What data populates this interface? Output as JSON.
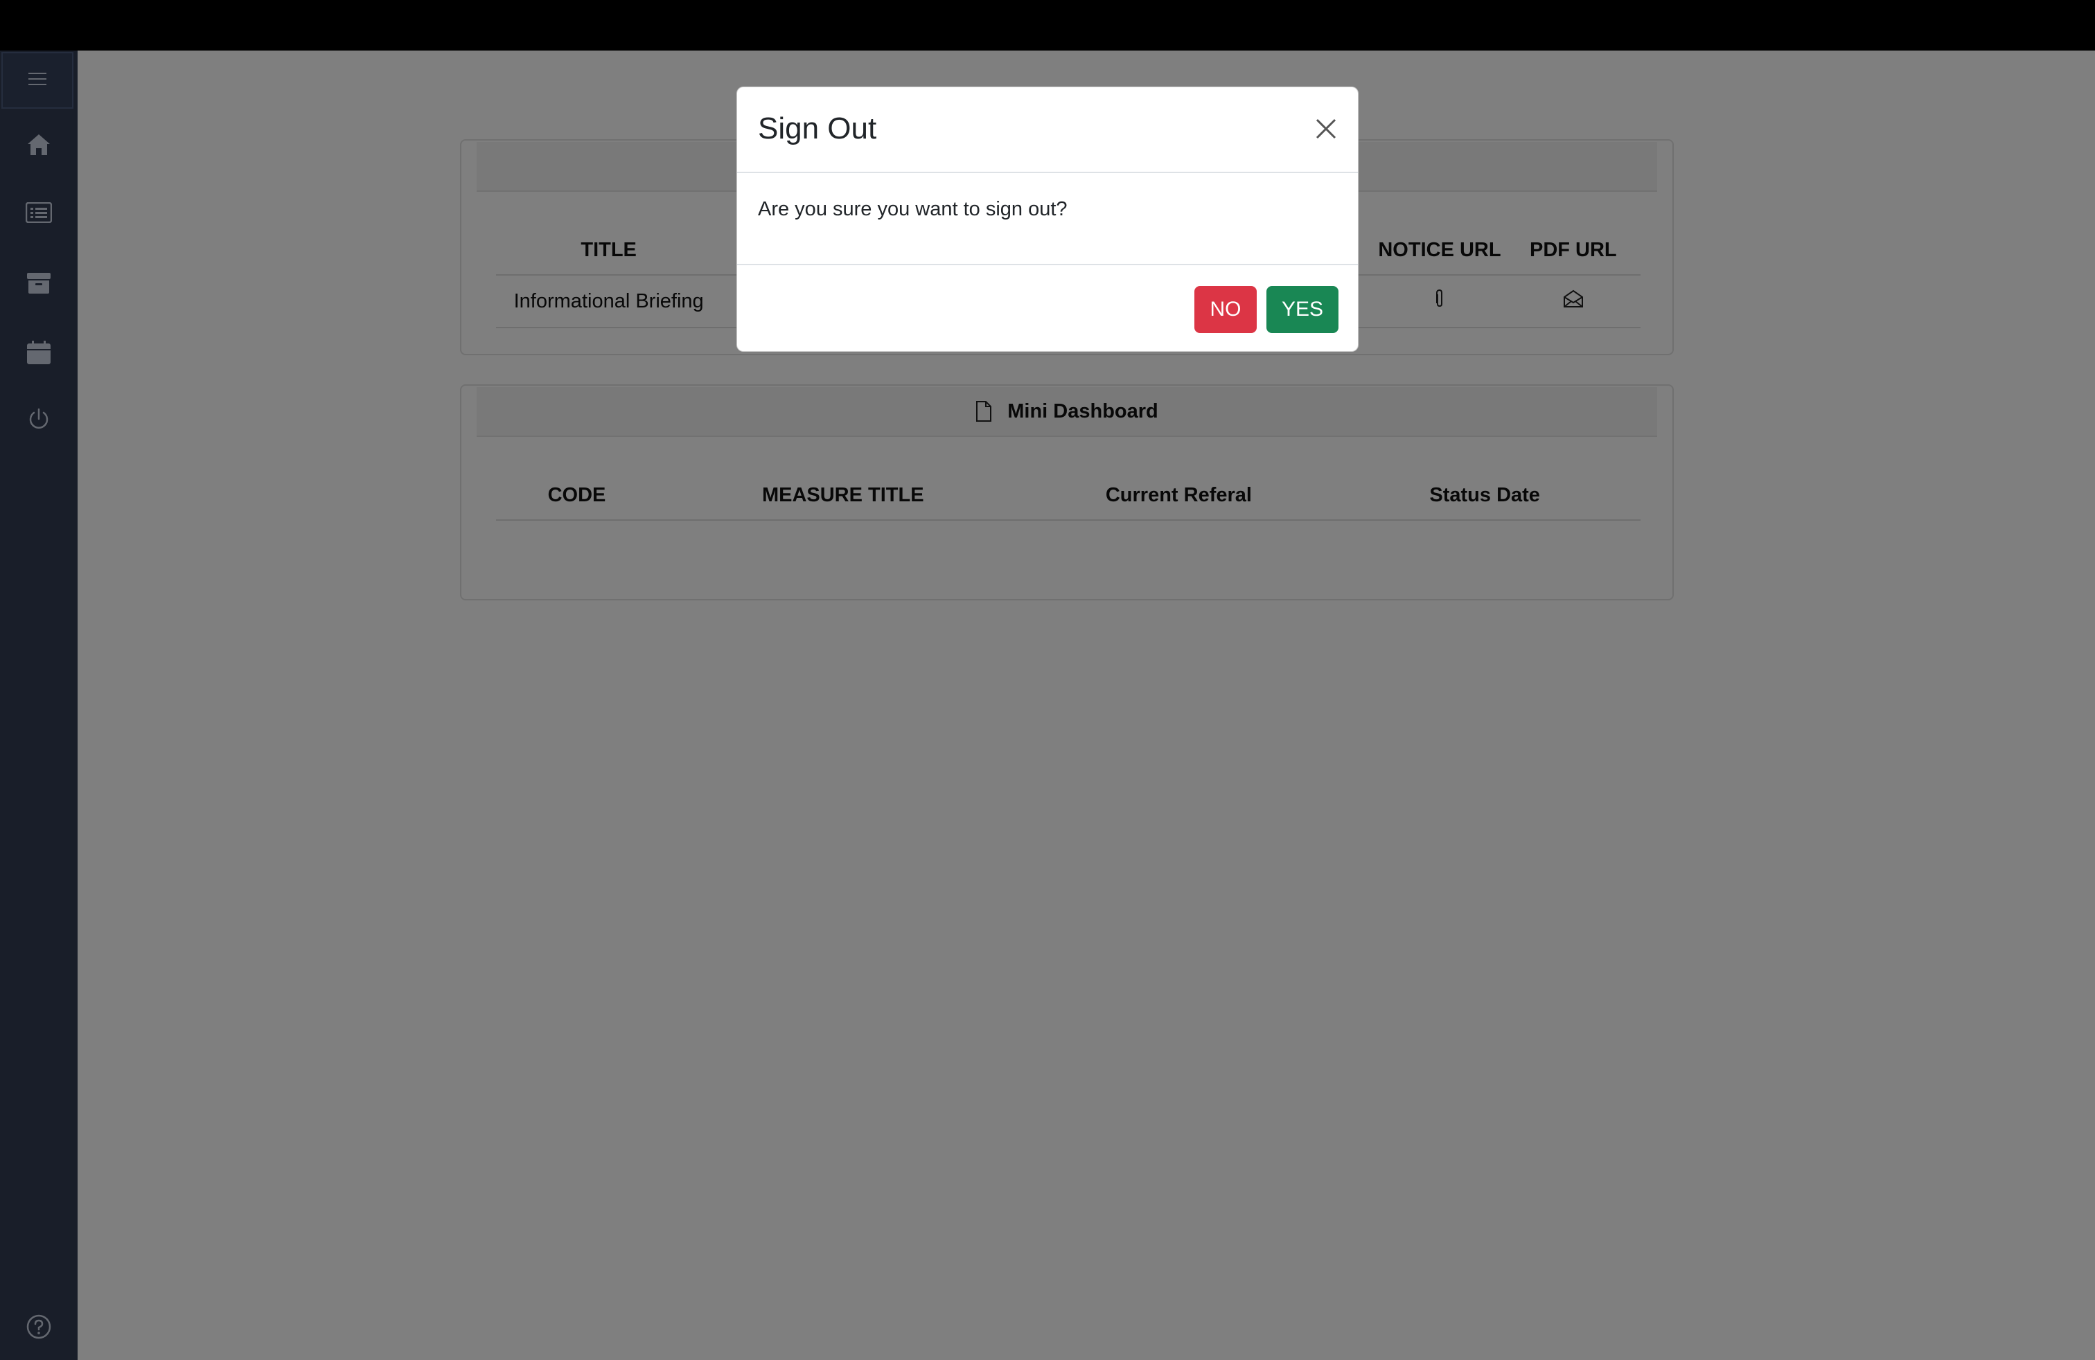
{
  "sidebar": {
    "toggle_icon": "hamburger-icon",
    "items": [
      {
        "icon": "home-icon"
      },
      {
        "icon": "list-icon"
      },
      {
        "icon": "archive-icon"
      },
      {
        "icon": "calendar-icon"
      },
      {
        "icon": "power-icon"
      }
    ],
    "help_icon": "help-icon"
  },
  "notices": {
    "columns": [
      "TITLE",
      "NOTICE URL",
      "PDF URL"
    ],
    "rows": [
      {
        "title": "Informational Briefing",
        "notice_icon": "paperclip-icon",
        "pdf_icon": "envelope-icon"
      }
    ]
  },
  "mini_dashboard": {
    "title": "Mini Dashboard",
    "columns": [
      "CODE",
      "MEASURE TITLE",
      "Current Referal",
      "Status Date"
    ]
  },
  "modal": {
    "title": "Sign Out",
    "message": "Are you sure you want to sign out?",
    "no_label": "NO",
    "yes_label": "YES"
  },
  "colors": {
    "sidebar": "#323c52",
    "no_button": "#dc3545",
    "yes_button": "#198754"
  }
}
